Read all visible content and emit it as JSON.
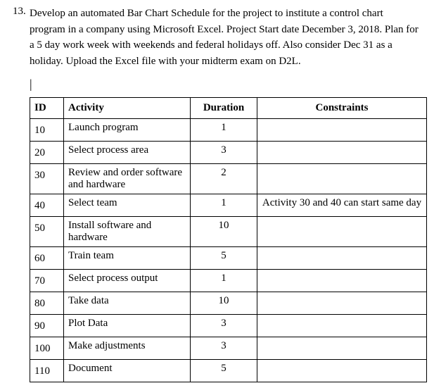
{
  "question": {
    "number": "13.",
    "text": "Develop an automated Bar Chart Schedule for the project to institute a control chart program in a company using Microsoft Excel. Project Start date December 3, 2018. Plan for a 5 day work week with weekends and federal holidays off. Also consider Dec 31 as a holiday. Upload the Excel file with your midterm exam on D2L."
  },
  "cursor": "|",
  "table": {
    "headers": {
      "id": "ID",
      "activity": "Activity",
      "duration": "Duration",
      "constraints": "Constraints"
    },
    "rows": [
      {
        "id": "10",
        "activity": "Launch program",
        "duration": "1",
        "constraints": ""
      },
      {
        "id": "20",
        "activity": "Select process area",
        "duration": "3",
        "constraints": ""
      },
      {
        "id": "30",
        "activity": "Review and order software and hardware",
        "duration": "2",
        "constraints": ""
      },
      {
        "id": "40",
        "activity": "Select team",
        "duration": "1",
        "constraints": "Activity 30 and 40 can start same day"
      },
      {
        "id": "50",
        "activity": "Install software and hardware",
        "duration": "10",
        "constraints": ""
      },
      {
        "id": "60",
        "activity": "Train team",
        "duration": "5",
        "constraints": ""
      },
      {
        "id": "70",
        "activity": "Select process output",
        "duration": "1",
        "constraints": ""
      },
      {
        "id": "80",
        "activity": "Take data",
        "duration": "10",
        "constraints": ""
      },
      {
        "id": "90",
        "activity": "Plot Data",
        "duration": "3",
        "constraints": ""
      },
      {
        "id": "100",
        "activity": "Make adjustments",
        "duration": "3",
        "constraints": ""
      },
      {
        "id": "110",
        "activity": "Document",
        "duration": "5",
        "constraints": ""
      }
    ]
  }
}
